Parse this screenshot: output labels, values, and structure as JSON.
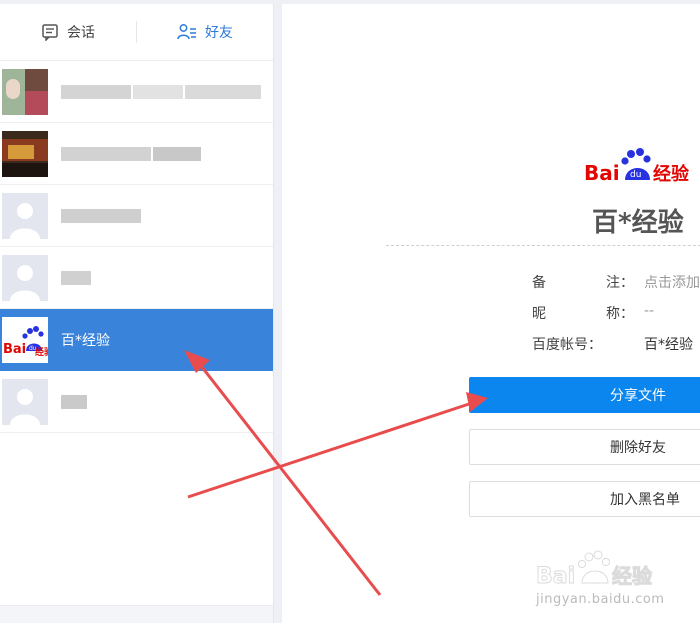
{
  "tabs": [
    {
      "label": "会话",
      "icon": "chat-icon",
      "active": false
    },
    {
      "label": "好友",
      "icon": "friends-icon",
      "active": true
    }
  ],
  "friends": [
    {
      "name": "",
      "blurred": true,
      "selected": false
    },
    {
      "name": "",
      "blurred": true,
      "selected": false
    },
    {
      "name": "",
      "blurred": true,
      "selected": false
    },
    {
      "name": "",
      "blurred": true,
      "selected": false
    },
    {
      "name": "百*经验",
      "blurred": false,
      "selected": true
    },
    {
      "name": "",
      "blurred": true,
      "selected": false
    }
  ],
  "profile": {
    "logo_text": "Bai经验",
    "title": "百*经验",
    "remark_label": [
      "备",
      "注："
    ],
    "remark_value": "点击添加",
    "nickname_label": [
      "昵",
      "称："
    ],
    "nickname_value": "--",
    "account_label": "百度帐号：",
    "account_value": "百*经验"
  },
  "actions": {
    "share": "分享文件",
    "delete": "删除好友",
    "blacklist": "加入黑名单"
  },
  "watermark": {
    "text": "jingyan.baidu.com"
  },
  "colors": {
    "accent": "#3a83db",
    "primary_button": "#0a86ee",
    "arrow": "#e84c4c",
    "baidu_red": "#e10602",
    "baidu_blue": "#2932e1"
  }
}
